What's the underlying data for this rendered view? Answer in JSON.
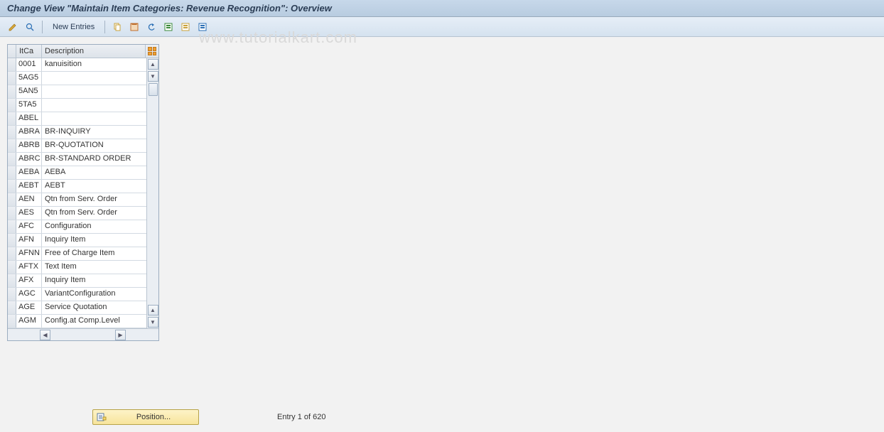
{
  "header": {
    "title": "Change View \"Maintain Item Categories: Revenue Recognition\": Overview"
  },
  "toolbar": {
    "new_entries_label": "New Entries"
  },
  "watermark": "www.tutorialkart.com",
  "table": {
    "col_itca": "ItCa",
    "col_desc": "Description",
    "rows": [
      {
        "itca": "0001",
        "desc": "kanuisition"
      },
      {
        "itca": "5AG5",
        "desc": ""
      },
      {
        "itca": "5AN5",
        "desc": ""
      },
      {
        "itca": "5TA5",
        "desc": ""
      },
      {
        "itca": "ABEL",
        "desc": ""
      },
      {
        "itca": "ABRA",
        "desc": "BR-INQUIRY"
      },
      {
        "itca": "ABRB",
        "desc": "BR-QUOTATION"
      },
      {
        "itca": "ABRC",
        "desc": "BR-STANDARD ORDER"
      },
      {
        "itca": "AEBA",
        "desc": "AEBA"
      },
      {
        "itca": "AEBT",
        "desc": "AEBT"
      },
      {
        "itca": "AEN",
        "desc": "Qtn from Serv. Order"
      },
      {
        "itca": "AES",
        "desc": "Qtn from Serv. Order"
      },
      {
        "itca": "AFC",
        "desc": "Configuration"
      },
      {
        "itca": "AFN",
        "desc": "Inquiry Item"
      },
      {
        "itca": "AFNN",
        "desc": "Free of Charge Item"
      },
      {
        "itca": "AFTX",
        "desc": "Text Item"
      },
      {
        "itca": "AFX",
        "desc": "Inquiry Item"
      },
      {
        "itca": "AGC",
        "desc": "VariantConfiguration"
      },
      {
        "itca": "AGE",
        "desc": "Service Quotation"
      },
      {
        "itca": "AGM",
        "desc": "Config.at Comp.Level"
      }
    ]
  },
  "footer": {
    "position_label": "Position...",
    "status": "Entry 1 of 620"
  }
}
